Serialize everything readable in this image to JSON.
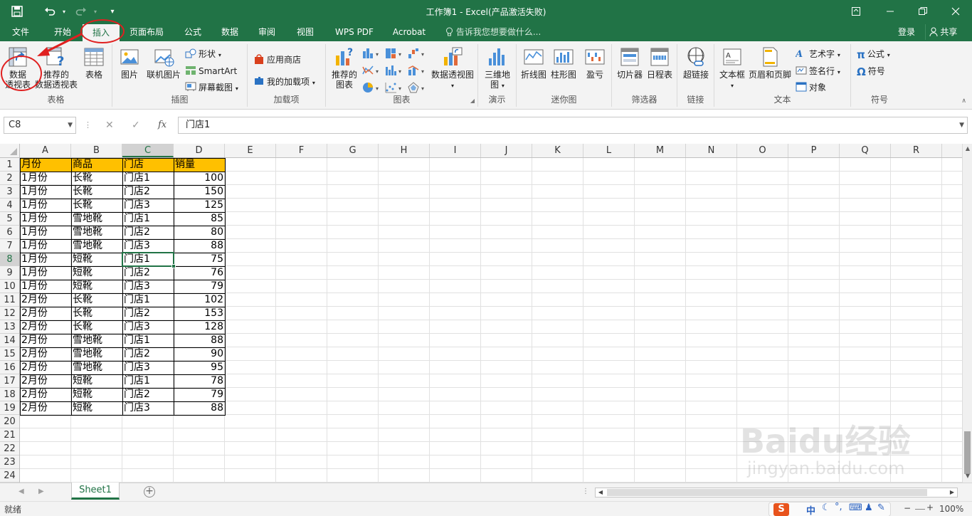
{
  "titlebar": {
    "title": "工作簿1 - Excel(产品激活失败)"
  },
  "tabs": [
    {
      "label": "文件",
      "active": false
    },
    {
      "label": "开始",
      "active": false
    },
    {
      "label": "插入",
      "active": true
    },
    {
      "label": "页面布局",
      "active": false
    },
    {
      "label": "公式",
      "active": false
    },
    {
      "label": "数据",
      "active": false
    },
    {
      "label": "审阅",
      "active": false
    },
    {
      "label": "视图",
      "active": false
    },
    {
      "label": "WPS PDF",
      "active": false
    },
    {
      "label": "Acrobat",
      "active": false
    }
  ],
  "tell_me": "告诉我您想要做什么...",
  "account": {
    "login": "登录",
    "share": "共享"
  },
  "ribbon": {
    "tables": {
      "group": "表格",
      "pivot_l1": "数据",
      "pivot_l2": "透视表",
      "rec_pivot_l1": "推荐的",
      "rec_pivot_l2": "数据透视表",
      "table": "表格"
    },
    "illustrations": {
      "group": "插图",
      "picture": "图片",
      "online_picture": "联机图片",
      "shapes": "形状",
      "smartart": "SmartArt",
      "screenshot": "屏幕截图"
    },
    "addins": {
      "group": "加载项",
      "store": "应用商店",
      "my_addins": "我的加载项"
    },
    "charts": {
      "group": "图表",
      "rec_l1": "推荐的",
      "rec_l2": "图表",
      "pivot_chart": "数据透视图"
    },
    "tours": {
      "group": "演示",
      "map_l1": "三维地",
      "map_l2": "图"
    },
    "sparklines": {
      "group": "迷你图",
      "line": "折线图",
      "column": "柱形图",
      "winloss": "盈亏"
    },
    "filters": {
      "group": "筛选器",
      "slicer": "切片器",
      "timeline": "日程表"
    },
    "links": {
      "group": "链接",
      "hyperlink": "超链接"
    },
    "text": {
      "group": "文本",
      "textbox": "文本框",
      "header_footer": "页眉和页脚",
      "wordart": "艺术字",
      "signature": "签名行",
      "object": "对象"
    },
    "symbols": {
      "group": "符号",
      "equation": "公式",
      "symbol": "符号"
    }
  },
  "formula_bar": {
    "name_box": "C8",
    "content": "门店1",
    "fx": "fx"
  },
  "columns": [
    "A",
    "B",
    "C",
    "D",
    "E",
    "F",
    "G",
    "H",
    "I",
    "J",
    "K",
    "L",
    "M",
    "N",
    "O",
    "P",
    "Q",
    "R"
  ],
  "selected_column": "C",
  "selected_row": 8,
  "rows": [
    "1",
    "2",
    "3",
    "4",
    "5",
    "6",
    "7",
    "8",
    "9",
    "10",
    "11",
    "12",
    "13",
    "14",
    "15",
    "16",
    "17",
    "18",
    "19",
    "20",
    "21",
    "22",
    "23",
    "24"
  ],
  "table": {
    "header": [
      "月份",
      "商品",
      "门店",
      "销量"
    ],
    "rows": [
      [
        "1月份",
        "长靴",
        "门店1",
        "100"
      ],
      [
        "1月份",
        "长靴",
        "门店2",
        "150"
      ],
      [
        "1月份",
        "长靴",
        "门店3",
        "125"
      ],
      [
        "1月份",
        "雪地靴",
        "门店1",
        "85"
      ],
      [
        "1月份",
        "雪地靴",
        "门店2",
        "80"
      ],
      [
        "1月份",
        "雪地靴",
        "门店3",
        "88"
      ],
      [
        "1月份",
        "短靴",
        "门店1",
        "75"
      ],
      [
        "1月份",
        "短靴",
        "门店2",
        "76"
      ],
      [
        "1月份",
        "短靴",
        "门店3",
        "79"
      ],
      [
        "2月份",
        "长靴",
        "门店1",
        "102"
      ],
      [
        "2月份",
        "长靴",
        "门店2",
        "153"
      ],
      [
        "2月份",
        "长靴",
        "门店3",
        "128"
      ],
      [
        "2月份",
        "雪地靴",
        "门店1",
        "88"
      ],
      [
        "2月份",
        "雪地靴",
        "门店2",
        "90"
      ],
      [
        "2月份",
        "雪地靴",
        "门店3",
        "95"
      ],
      [
        "2月份",
        "短靴",
        "门店1",
        "78"
      ],
      [
        "2月份",
        "短靴",
        "门店2",
        "79"
      ],
      [
        "2月份",
        "短靴",
        "门店3",
        "88"
      ]
    ]
  },
  "sheet_tab": "Sheet1",
  "status": {
    "ready": "就绪",
    "zoom": "100%",
    "ime": "中"
  },
  "watermark": {
    "brand": "Baidu经验",
    "url": "jingyan.baidu.com"
  },
  "colors": {
    "excel_green": "#217346",
    "header_fill": "#ffc000",
    "annotation_red": "#e02020"
  }
}
